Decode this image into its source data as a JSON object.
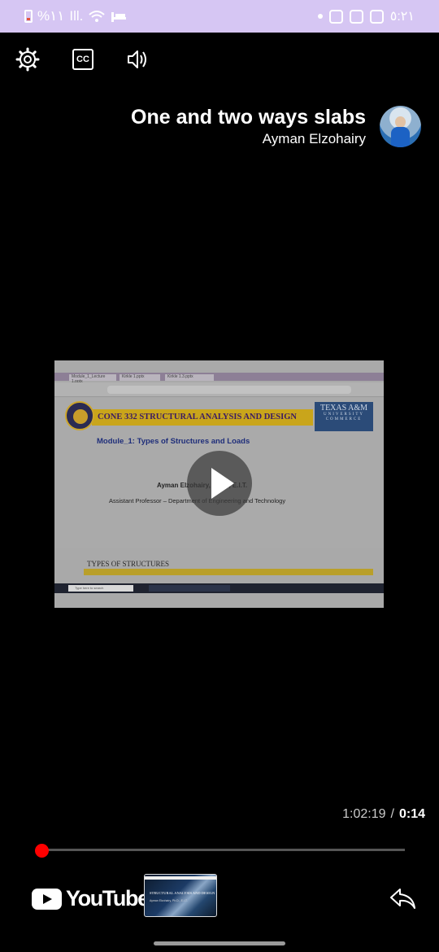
{
  "status_bar": {
    "battery_text": "%١١",
    "signal": "Ill.",
    "clock": "٥:٢١",
    "icons": [
      "battery-icon",
      "signal-icon",
      "wifi-icon",
      "sleep-icon",
      "notification-dot-icon",
      "instagram-icon",
      "check-icon",
      "gallery-icon"
    ]
  },
  "player_controls": {
    "settings_icon": "gear-icon",
    "captions_label": "CC",
    "volume_icon": "speaker-icon"
  },
  "video": {
    "title": "One and two ways slabs",
    "channel": "Ayman Elzohairy",
    "avatar": "channel-avatar",
    "frame": {
      "tabs": [
        "Module_1_Lecture 1.pptx",
        "Kirkle 1.pptx",
        "Kirkle 1.3.pptx"
      ],
      "course_header": "CONE 332 STRUCTURAL ANALYSIS AND DESIGN",
      "university": "TEXAS A&M",
      "university_sub": "UNIVERSITY COMMERCE",
      "module_title": "Module_1: Types of Structures and Loads",
      "presenter": "Ayman Elzohairy, Ph.D., E.I.T.",
      "presenter_role": "Assistant Professor – Department of Engineering and Technology",
      "next_slide_heading": "TYPES OF STRUCTURES",
      "taskbar_search": "Type here to search"
    },
    "play_icon": "play-icon"
  },
  "playback": {
    "current_time": "1:02:19",
    "separator": "/",
    "duration": "0:14",
    "progress_fraction": 0.0
  },
  "bottom_bar": {
    "logo_text": "YouTube",
    "logo_icon": "youtube-icon",
    "thumbnail_title": "STRUCTURAL ANALYSIS AND DESIGN",
    "thumbnail_sub": "Ayman Elzohairy, Ph.D., E.I.T.",
    "share_icon": "share-icon"
  },
  "colors": {
    "status_bar_bg": "#d6c6f3",
    "progress_red": "#ff0000",
    "background": "#000000"
  }
}
